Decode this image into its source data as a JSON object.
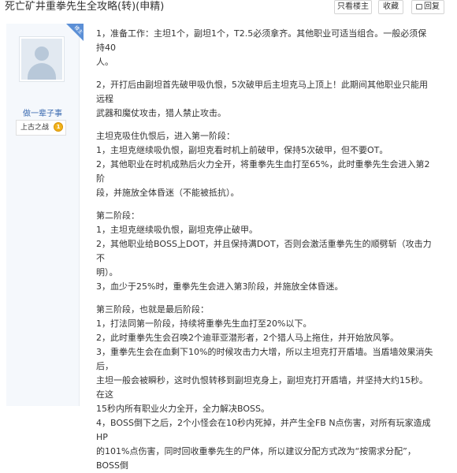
{
  "thread": {
    "title": "死亡矿井重拳先生全攻略(转)(申精)",
    "buttons": {
      "only_op": "只看楼主",
      "favorite": "收藏",
      "reply": "回复"
    }
  },
  "author": {
    "badge": "楼主",
    "name": "做一辈子事",
    "rank": "上古之战",
    "medal": "1"
  },
  "content": {
    "para1_line1": "1，准备工作：主坦1个，副坦1个，T2.5必须拿齐。其他职业可适当组合。一般必须保持40",
    "para1_line2": "人。",
    "para2_line1": "2，开打后由副坦首先破甲吸仇恨，5次破甲后主坦克马上顶上！此期间其他职业只能用远程",
    "para2_line2": "武器和魔仗攻击，猎人禁止攻击。",
    "phase1_title": "主坦克吸住仇恨后，进入第一阶段：",
    "phase1_l1": "1，主坦克继续吸仇恨，副坦克看时机上前破甲，保持5次破甲，但不要OT。",
    "phase1_l2": "2，其他职业在时机成熟后火力全开，将重拳先生血打至65%，此时重拳先生会进入第2阶",
    "phase1_l3": "段，并施放全体昏迷（不能被抵抗）。",
    "phase2_title": "第二阶段：",
    "phase2_l1": "1，主坦克继续吸仇恨，副坦克停止破甲。",
    "phase2_l2": "2，其他职业给BOSS上DOT，并且保持满DOT，否则会激活重拳先生的顺劈斩（攻击力不",
    "phase2_l3": "明）。",
    "phase2_l4": "3，血少于25%时，重拳先生会进入第3阶段，并施放全体昏迷。",
    "phase3_title": "第三阶段，也就是最后阶段：",
    "phase3_l1": "1，打法同第一阶段，持续将重拳先生血打至20%以下。",
    "phase3_l2": "2，此时重拳先生会召唤2个迪菲亚潜形者，2个猎人马上拖住，并开始放风筝。",
    "phase3_l3": "3，重拳先生会在血剩下10%的时候攻击力大增，所以主坦克打开盾墙。当盾墙效果消失后，",
    "phase3_l4": "主坦一般会被瞬秒，这时仇恨转移到副坦克身上，副坦克打开盾墙，并坚持大约15秒。在这",
    "phase3_l5": "15秒内所有职业火力全开，全力解决BOSS。",
    "phase3_l6": "4，BOSS倒下之后，2个小怪会在10秒内死掉，并产生全FB N点伤害，对所有玩家造成HP",
    "phase3_l7": "的101%点伤害，同时回收重拳先生的尸体，所以建议分配方式改为“按需求分配”，BOSS倒"
  }
}
